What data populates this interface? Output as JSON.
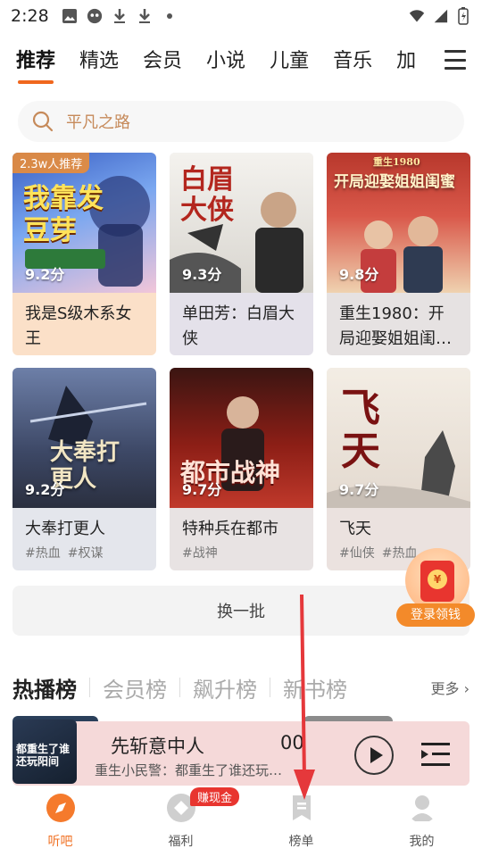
{
  "status_bar": {
    "time": "2:28"
  },
  "tabs": [
    {
      "label": "推荐",
      "active": true
    },
    {
      "label": "精选"
    },
    {
      "label": "会员"
    },
    {
      "label": "小说"
    },
    {
      "label": "儿童"
    },
    {
      "label": "音乐"
    },
    {
      "label": "加"
    }
  ],
  "search": {
    "placeholder": "平凡之路"
  },
  "books": [
    {
      "title": "我是S级木系女王",
      "score": "9.2分",
      "badge": "2.3w人推荐",
      "cover_text": "我靠发豆芽",
      "tags": []
    },
    {
      "title": "单田芳：白眉大侠",
      "score": "9.3分",
      "cover_text": "白眉大侠",
      "tags": []
    },
    {
      "title": "重生1980：开局迎娶姐姐闺…",
      "score": "9.8分",
      "cover_text": "开局迎娶姐姐闺蜜",
      "cover_small": "重生1980",
      "tags": []
    },
    {
      "title": "大奉打更人",
      "score": "9.2分",
      "cover_text": "大奉打更人",
      "tags": [
        "#热血",
        "#权谋"
      ]
    },
    {
      "title": "特种兵在都市",
      "score": "9.7分",
      "cover_text": "都市战神",
      "tags": [
        "#战神"
      ]
    },
    {
      "title": "飞天",
      "score": "9.7分",
      "cover_text": "飞天",
      "tags": [
        "#仙侠",
        "#热血"
      ]
    }
  ],
  "refresh_label": "换一批",
  "red_packet": {
    "label": "登录领钱",
    "coin": "¥"
  },
  "rank_tabs": [
    {
      "label": "热播榜",
      "active": true
    },
    {
      "label": "会员榜"
    },
    {
      "label": "飙升榜"
    },
    {
      "label": "新书榜"
    }
  ],
  "rank_more": "更多 ›",
  "player": {
    "title": "先斩意中人",
    "time": "00",
    "subtitle": "重生小民警：都重生了谁还玩…",
    "cover_text": "都重生了谁还玩阳间"
  },
  "bottom_nav": [
    {
      "label": "听吧",
      "active": true
    },
    {
      "label": "福利",
      "badge": "赚现金"
    },
    {
      "label": "榜单"
    },
    {
      "label": "我的"
    }
  ],
  "colors": {
    "accent": "#f0671e",
    "player_bg": "#f5d9d9",
    "annotation": "#e5383b"
  }
}
